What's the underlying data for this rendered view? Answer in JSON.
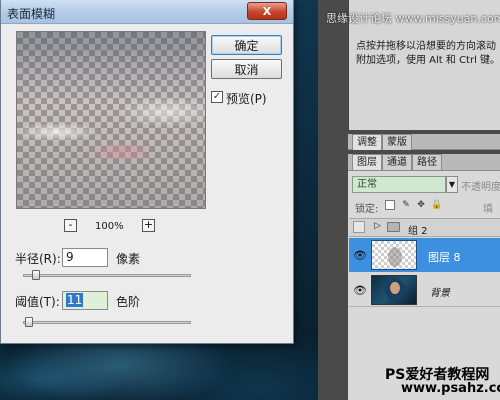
{
  "dialog": {
    "title": "表面模糊",
    "close_label": "X",
    "ok_label": "确定",
    "cancel_label": "取消",
    "preview_checkbox": {
      "label": "预览(P)",
      "checked": true,
      "check_glyph": "✓"
    },
    "zoom": {
      "out_label": "-",
      "in_label": "+",
      "level": "100%"
    },
    "radius": {
      "label": "半径(R):",
      "value": "9",
      "unit": "像素"
    },
    "threshold": {
      "label": "阈值(T):",
      "value": "11",
      "unit": "色阶"
    }
  },
  "info_panel": {
    "watermark": "思缘设计论坛 www.missyuan.com",
    "line1": "点按并拖移以沿想要的方向滚动",
    "line2": "附加选项，使用 Alt 和 Ctrl 键。"
  },
  "panel_tabs": {
    "adjust": "调整",
    "masks": "蒙版"
  },
  "layers_panel": {
    "tabs": {
      "layers": "图层",
      "channels": "通道",
      "paths": "路径"
    },
    "blend_mode": "正常",
    "blend_arrow": "▼",
    "opacity_label": "不透明度",
    "lock_label": "锁定:",
    "lock_icons": {
      "brush": "✎",
      "move": "✥",
      "all": "🔒"
    },
    "fill_label": "填充",
    "group": {
      "toggle_glyph": "▷",
      "name": "组 2"
    },
    "eye_glyph": "👁",
    "layers": [
      {
        "name": "图层 8",
        "selected": true
      },
      {
        "name": "背景",
        "selected": false
      }
    ]
  },
  "watermark_bottom": {
    "line1": "PS爱好者教程网",
    "line2": "www.psahz.com"
  },
  "colors": {
    "selected_layer": "#3d8fe0",
    "blend_select_bg": "#cfe8cf",
    "close_button": "#c8452c"
  }
}
